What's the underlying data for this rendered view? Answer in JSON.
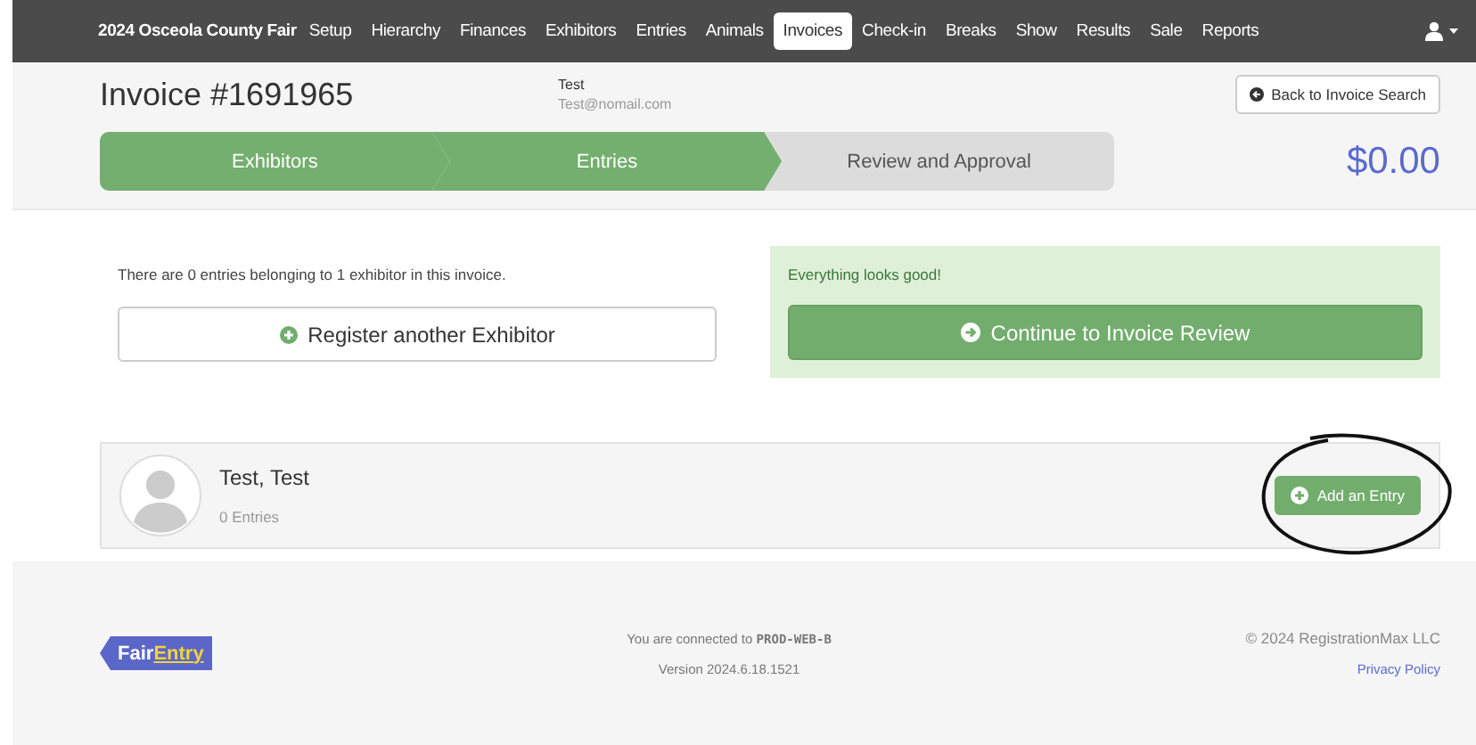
{
  "nav": {
    "brand": "2024 Osceola County Fair",
    "items": [
      {
        "label": "Setup",
        "selected": false
      },
      {
        "label": "Hierarchy",
        "selected": false
      },
      {
        "label": "Finances",
        "selected": false
      },
      {
        "label": "Exhibitors",
        "selected": false
      },
      {
        "label": "Entries",
        "selected": false
      },
      {
        "label": "Animals",
        "selected": false
      },
      {
        "label": "Invoices",
        "selected": true
      },
      {
        "label": "Check-in",
        "selected": false
      },
      {
        "label": "Breaks",
        "selected": false
      },
      {
        "label": "Show",
        "selected": false
      },
      {
        "label": "Results",
        "selected": false
      },
      {
        "label": "Sale",
        "selected": false
      },
      {
        "label": "Reports",
        "selected": false
      }
    ]
  },
  "invoice": {
    "title": "Invoice #1691965",
    "contact_name": "Test",
    "contact_email": "Test@nomail.com",
    "back_button": "Back to Invoice Search",
    "total": "$0.00"
  },
  "steps": [
    {
      "label": "Exhibitors",
      "done": true
    },
    {
      "label": "Entries",
      "done": true
    },
    {
      "label": "Review and Approval",
      "done": false
    }
  ],
  "summary": {
    "text": "There are 0 entries belonging to 1 exhibitor in this invoice.",
    "register_button": "Register another Exhibitor"
  },
  "status": {
    "text": "Everything looks good!",
    "continue_button": "Continue to Invoice Review"
  },
  "exhibitors": [
    {
      "name": "Test, Test",
      "entries": "0 Entries",
      "add_button": "Add an Entry",
      "circled": true
    }
  ],
  "footer": {
    "logo_part1": "Fair",
    "logo_part2": "Entry",
    "connected_text": "You are connected to",
    "server": "PROD-WEB-B",
    "version": "Version 2024.6.18.1521",
    "copyright": "© 2024 RegistrationMax LLC",
    "privacy_link": "Privacy Policy"
  }
}
